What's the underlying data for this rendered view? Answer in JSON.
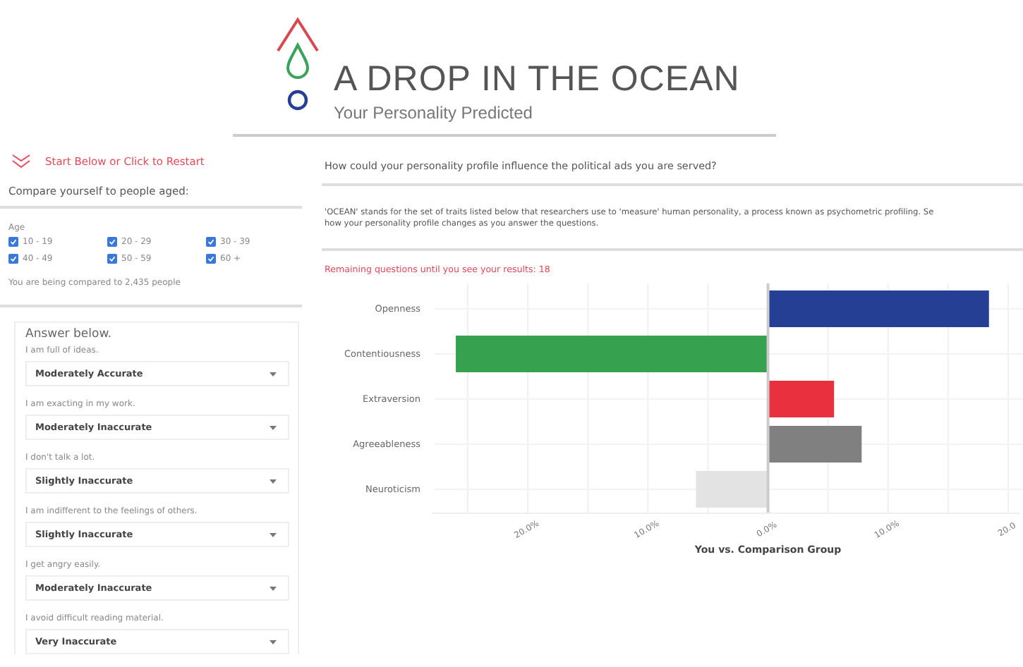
{
  "header": {
    "title": "A DROP IN THE OCEAN",
    "subtitle": "Your Personality Predicted"
  },
  "sidebar": {
    "restart_link": "Start Below or Click to Restart",
    "compare_heading": "Compare yourself to people aged:",
    "age_label": "Age",
    "age_groups": [
      {
        "label": "10 - 19",
        "checked": true
      },
      {
        "label": "20 - 29",
        "checked": true
      },
      {
        "label": "30 - 39",
        "checked": true
      },
      {
        "label": "40 - 49",
        "checked": true
      },
      {
        "label": "50 - 59",
        "checked": true
      },
      {
        "label": "60 +",
        "checked": true
      }
    ],
    "comparison_note": "You are being compared to 2,435 people",
    "answers_heading": "Answer below.",
    "questions": [
      {
        "prompt": "I am full of ideas.",
        "answer": "Moderately Accurate"
      },
      {
        "prompt": "I am exacting in my work.",
        "answer": "Moderately Inaccurate"
      },
      {
        "prompt": "I don't talk a lot.",
        "answer": "Slightly Inaccurate"
      },
      {
        "prompt": "I am indifferent to the feelings of others.",
        "answer": "Slightly Inaccurate"
      },
      {
        "prompt": "I get angry easily.",
        "answer": "Moderately Inaccurate"
      },
      {
        "prompt": "I avoid difficult reading material.",
        "answer": "Very Inaccurate"
      }
    ]
  },
  "main": {
    "heading": "How could your personality profile influence the political ads you are served?",
    "intro_lines": [
      "'OCEAN' stands for the set of traits listed below that researchers use to 'measure' human personality, a process known as psychometric profiling. Se",
      "how your personality profile changes as you answer the questions."
    ],
    "remaining": "Remaining questions until you see your results: 18",
    "chart": {
      "bars": [
        {
          "color": "#253f94"
        },
        {
          "color": "#36a24f"
        },
        {
          "color": "#e8303f"
        },
        {
          "color": "#808080"
        },
        {
          "color": "#e3e3e3"
        }
      ],
      "chart_data": {
        "type": "bar",
        "orientation": "horizontal",
        "grid": true,
        "xlabel": "You vs. Comparison Group",
        "categories": [
          "Openness",
          "Contentiousness",
          "Extraversion",
          "Agreeableness",
          "Neuroticism"
        ],
        "values": [
          18.4,
          -26,
          5.5,
          7.8,
          -6
        ],
        "xlim": [
          -28,
          21
        ],
        "xticks": [
          {
            "value": -20,
            "label": "20.0%"
          },
          {
            "value": -10,
            "label": "10.0%"
          },
          {
            "value": 0,
            "label": "0.0%"
          },
          {
            "value": 10,
            "label": "10.0%"
          },
          {
            "value": 20,
            "label": "20.0"
          }
        ]
      }
    }
  }
}
